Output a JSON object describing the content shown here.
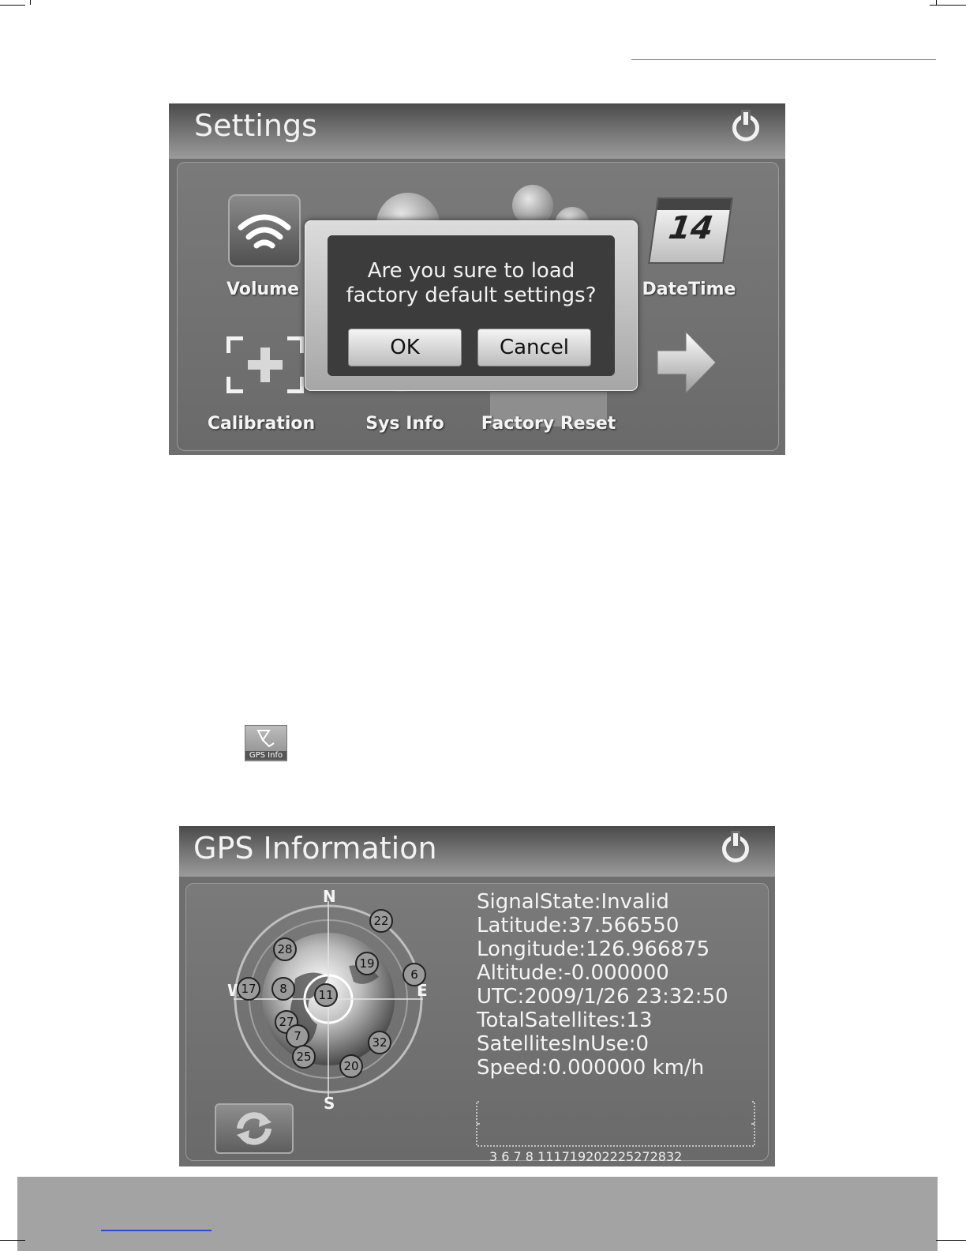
{
  "settings": {
    "title": "Settings",
    "icons": [
      {
        "label": "Volume"
      },
      {
        "label": "DateTime"
      },
      {
        "label": "Calibration"
      },
      {
        "label": "Sys Info"
      },
      {
        "label": "Factory Reset"
      }
    ],
    "calendar_day": "14",
    "dialog": {
      "line1": "Are you sure to load",
      "line2": "factory default settings?",
      "ok_label": "OK",
      "cancel_label": "Cancel"
    }
  },
  "launcher": {
    "gps_info_label": "GPS Info"
  },
  "gps": {
    "title": "GPS Information",
    "compass": {
      "n": "N",
      "s": "S",
      "e": "E",
      "w": "W"
    },
    "satellites": [
      "22",
      "28",
      "19",
      "6",
      "17",
      "8",
      "11",
      "27",
      "7",
      "32",
      "25",
      "20"
    ],
    "info": [
      "SignalState:Invalid",
      "Latitude:37.566550",
      "Longitude:126.966875",
      "Altitude:-0.000000",
      "UTC:2009/1/26 23:32:50",
      "TotalSatellites:13",
      "SatellitesInUse:0",
      "Speed:0.000000 km/h"
    ],
    "signal_axis": "3 6 7 8 111719202225272832"
  },
  "colors": {
    "screen_bg": "#6e6e6e",
    "footer_bar": "#a3a3a3",
    "link": "#2a4bd6"
  }
}
